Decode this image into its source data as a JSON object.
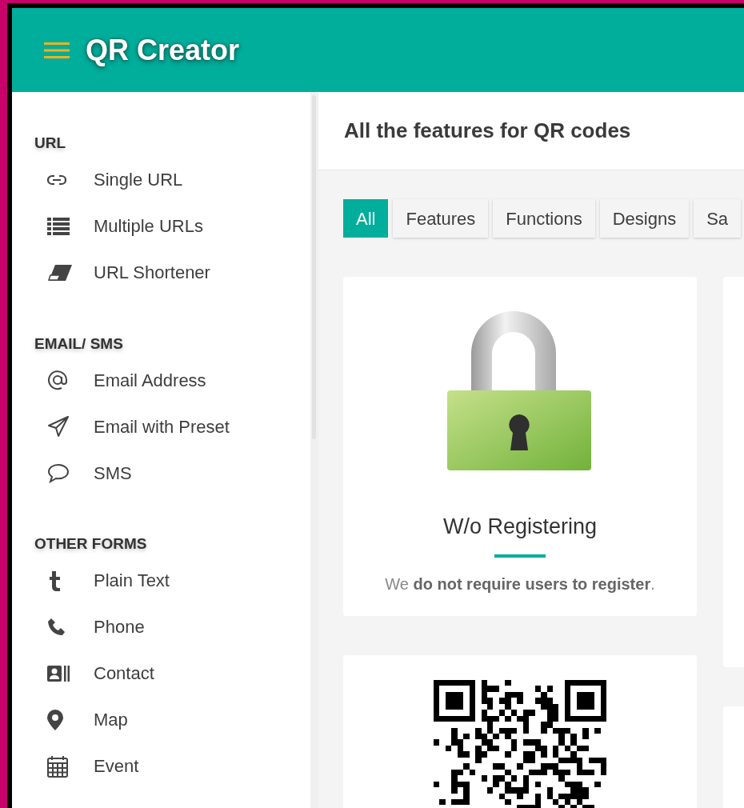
{
  "header": {
    "title": "QR Creator"
  },
  "sidebar": {
    "sections": [
      {
        "heading": "URL",
        "items": [
          {
            "label": "Single URL"
          },
          {
            "label": "Multiple URLs"
          },
          {
            "label": "URL Shortener"
          }
        ]
      },
      {
        "heading": "EMAIL/ SMS",
        "items": [
          {
            "label": "Email Address"
          },
          {
            "label": "Email with Preset"
          },
          {
            "label": "SMS"
          }
        ]
      },
      {
        "heading": "OTHER FORMS",
        "items": [
          {
            "label": "Plain Text"
          },
          {
            "label": "Phone"
          },
          {
            "label": "Contact"
          },
          {
            "label": "Map"
          },
          {
            "label": "Event"
          }
        ]
      }
    ]
  },
  "main": {
    "title": "All the features for QR codes",
    "tabs": [
      {
        "label": "All",
        "selected": true
      },
      {
        "label": "Features",
        "selected": false
      },
      {
        "label": "Functions",
        "selected": false
      },
      {
        "label": "Designs",
        "selected": false
      },
      {
        "label": "Sa",
        "selected": false
      }
    ],
    "cards": [
      {
        "kind": "lock",
        "title": "W/o Registering",
        "text": "We **do not require users to register**."
      },
      {
        "kind": "qr"
      }
    ]
  }
}
